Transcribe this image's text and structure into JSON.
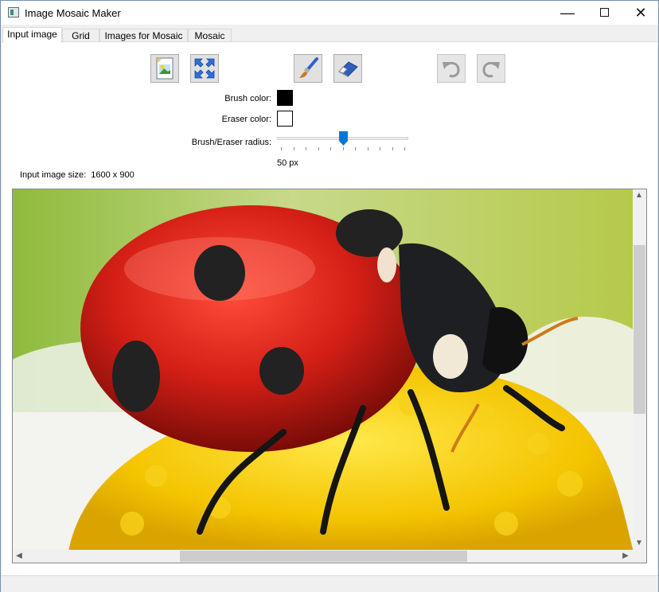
{
  "window": {
    "title": "Image Mosaic Maker"
  },
  "tabs": [
    {
      "label": "Input image",
      "active": true
    },
    {
      "label": "Grid",
      "active": false
    },
    {
      "label": "Images for Mosaic",
      "active": false
    },
    {
      "label": "Mosaic",
      "active": false
    }
  ],
  "toolbar": {
    "buttons": [
      {
        "icon": "open-image-icon",
        "enabled": true
      },
      {
        "icon": "fit-to-window-icon",
        "enabled": true
      },
      {
        "icon": "brush-icon",
        "enabled": true
      },
      {
        "icon": "eraser-icon",
        "enabled": true
      },
      {
        "icon": "undo-icon",
        "enabled": false
      },
      {
        "icon": "redo-icon",
        "enabled": false
      }
    ]
  },
  "settings": {
    "brush_color_label": "Brush color:",
    "brush_color": "#000000",
    "eraser_color_label": "Eraser color:",
    "eraser_color": "#ffffff",
    "radius_label": "Brush/Eraser radius:",
    "radius_value": "50 px",
    "slider_fraction": 0.5
  },
  "image_info": {
    "label": "Input image size:",
    "value": "1600 x 900"
  },
  "accent_color": "#0078d7"
}
